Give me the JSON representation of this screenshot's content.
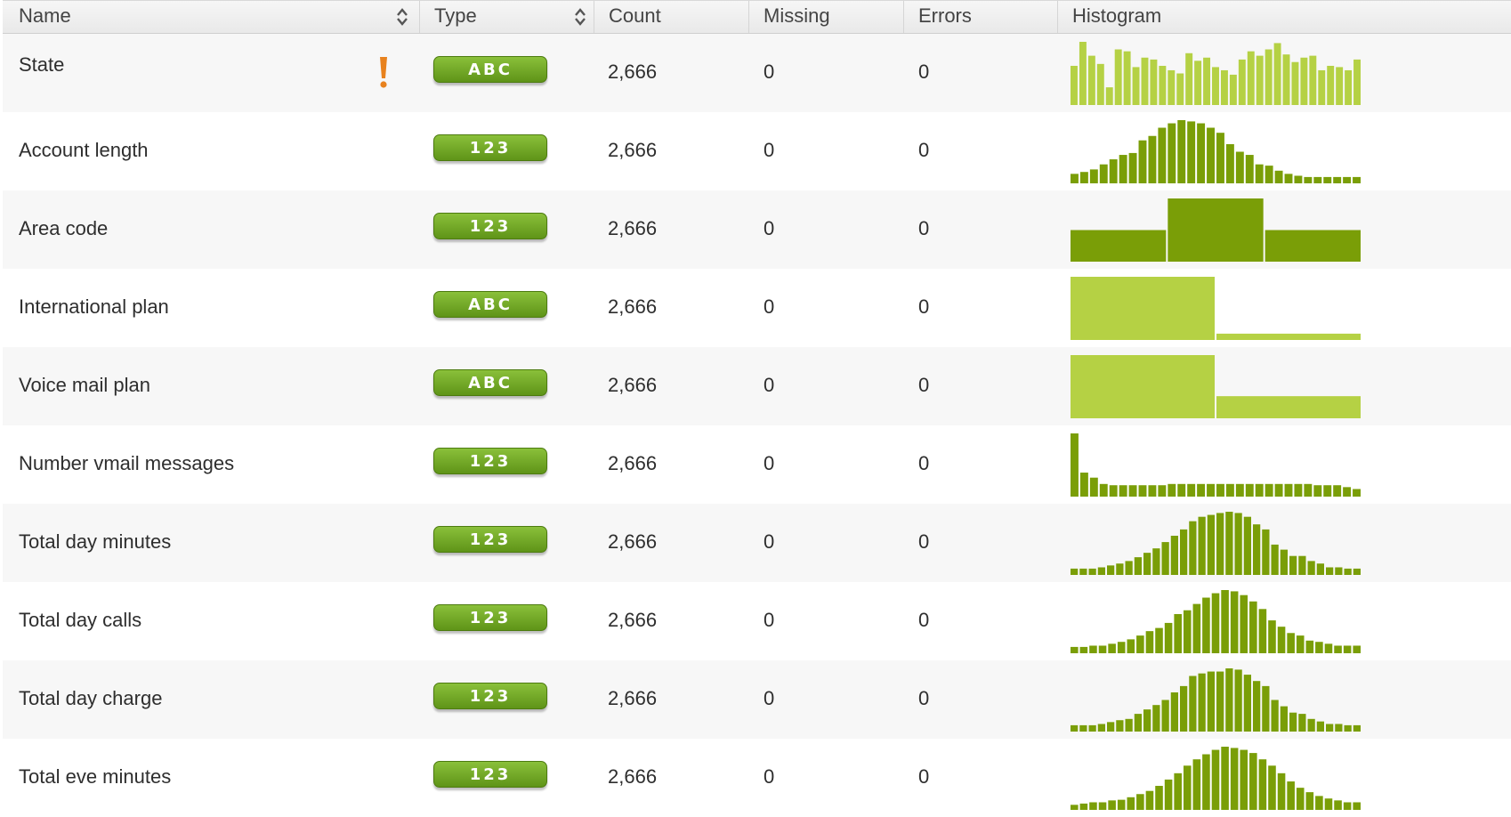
{
  "header": {
    "name": "Name",
    "type": "Type",
    "count": "Count",
    "missing": "Missing",
    "errors": "Errors",
    "histogram": "Histogram"
  },
  "colors": {
    "dark_green": "#7a9e07",
    "light_green": "#b5d144",
    "pale_gray": "#dddddd",
    "warning_orange": "#e8821e"
  },
  "rows": [
    {
      "name": "State",
      "type": "ABC",
      "count": "2,666",
      "missing": "0",
      "errors": "0",
      "warning": true,
      "histogram": {
        "color": "light",
        "bins": [
          0.62,
          1.0,
          0.78,
          0.65,
          0.28,
          0.88,
          0.85,
          0.6,
          0.75,
          0.72,
          0.62,
          0.55,
          0.5,
          0.82,
          0.7,
          0.75,
          0.6,
          0.55,
          0.48,
          0.72,
          0.85,
          0.78,
          0.88,
          0.98,
          0.8,
          0.68,
          0.75,
          0.78,
          0.55,
          0.62,
          0.6,
          0.55,
          0.72
        ]
      }
    },
    {
      "name": "Account length",
      "type": "123",
      "count": "2,666",
      "missing": "0",
      "errors": "0",
      "warning": false,
      "histogram": {
        "color": "dark",
        "bins": [
          0.15,
          0.18,
          0.22,
          0.3,
          0.38,
          0.45,
          0.48,
          0.68,
          0.75,
          0.88,
          0.95,
          1.0,
          0.98,
          0.95,
          0.88,
          0.8,
          0.62,
          0.5,
          0.45,
          0.3,
          0.28,
          0.2,
          0.15,
          0.12,
          0.1,
          0.1,
          0.1,
          0.1,
          0.1,
          0.1
        ]
      }
    },
    {
      "name": "Area code",
      "type": "123",
      "count": "2,666",
      "missing": "0",
      "errors": "0",
      "warning": false,
      "histogram": {
        "color": "dark",
        "bins": [
          0.5,
          1.0,
          0.5
        ]
      }
    },
    {
      "name": "International plan",
      "type": "ABC",
      "count": "2,666",
      "missing": "0",
      "errors": "0",
      "warning": false,
      "histogram": {
        "color": "light",
        "bins": [
          1.0,
          0.1
        ]
      }
    },
    {
      "name": "Voice mail plan",
      "type": "ABC",
      "count": "2,666",
      "missing": "0",
      "errors": "0",
      "warning": false,
      "histogram": {
        "color": "light",
        "bins": [
          1.0,
          0.35
        ]
      }
    },
    {
      "name": "Number vmail messages",
      "type": "123",
      "count": "2,666",
      "missing": "0",
      "errors": "0",
      "warning": false,
      "histogram": {
        "color": "dark",
        "bins": [
          1.0,
          0.38,
          0.3,
          0.2,
          0.18,
          0.18,
          0.18,
          0.18,
          0.18,
          0.18,
          0.2,
          0.2,
          0.2,
          0.2,
          0.2,
          0.2,
          0.2,
          0.2,
          0.2,
          0.2,
          0.2,
          0.2,
          0.2,
          0.2,
          0.2,
          0.18,
          0.18,
          0.18,
          0.15,
          0.12
        ]
      }
    },
    {
      "name": "Total day minutes",
      "type": "123",
      "count": "2,666",
      "missing": "0",
      "errors": "0",
      "warning": false,
      "histogram": {
        "color": "dark",
        "bins": [
          0.1,
          0.1,
          0.1,
          0.12,
          0.15,
          0.18,
          0.22,
          0.28,
          0.35,
          0.42,
          0.52,
          0.62,
          0.72,
          0.85,
          0.92,
          0.95,
          0.98,
          1.0,
          0.98,
          0.92,
          0.8,
          0.72,
          0.48,
          0.4,
          0.3,
          0.3,
          0.22,
          0.18,
          0.12,
          0.12,
          0.1,
          0.1
        ]
      }
    },
    {
      "name": "Total day calls",
      "type": "123",
      "count": "2,666",
      "missing": "0",
      "errors": "0",
      "warning": false,
      "histogram": {
        "color": "dark",
        "bins": [
          0.1,
          0.1,
          0.12,
          0.12,
          0.15,
          0.18,
          0.22,
          0.28,
          0.35,
          0.4,
          0.48,
          0.62,
          0.68,
          0.78,
          0.88,
          0.95,
          1.0,
          0.98,
          0.92,
          0.82,
          0.7,
          0.52,
          0.42,
          0.32,
          0.28,
          0.2,
          0.18,
          0.15,
          0.12,
          0.12,
          0.12
        ]
      }
    },
    {
      "name": "Total day charge",
      "type": "123",
      "count": "2,666",
      "missing": "0",
      "errors": "0",
      "warning": false,
      "histogram": {
        "color": "dark",
        "bins": [
          0.1,
          0.1,
          0.1,
          0.12,
          0.15,
          0.18,
          0.2,
          0.28,
          0.35,
          0.42,
          0.5,
          0.62,
          0.72,
          0.88,
          0.92,
          0.95,
          0.95,
          1.0,
          0.98,
          0.9,
          0.8,
          0.72,
          0.5,
          0.4,
          0.3,
          0.28,
          0.2,
          0.16,
          0.12,
          0.12,
          0.1,
          0.1
        ]
      }
    },
    {
      "name": "Total eve minutes",
      "type": "123",
      "count": "2,666",
      "missing": "0",
      "errors": "0",
      "warning": false,
      "histogram": {
        "color": "dark",
        "bins": [
          0.08,
          0.1,
          0.12,
          0.12,
          0.15,
          0.16,
          0.2,
          0.25,
          0.3,
          0.38,
          0.48,
          0.58,
          0.7,
          0.8,
          0.88,
          0.95,
          1.0,
          0.98,
          0.95,
          0.9,
          0.8,
          0.7,
          0.58,
          0.45,
          0.35,
          0.28,
          0.22,
          0.18,
          0.15,
          0.12,
          0.12
        ]
      }
    }
  ]
}
